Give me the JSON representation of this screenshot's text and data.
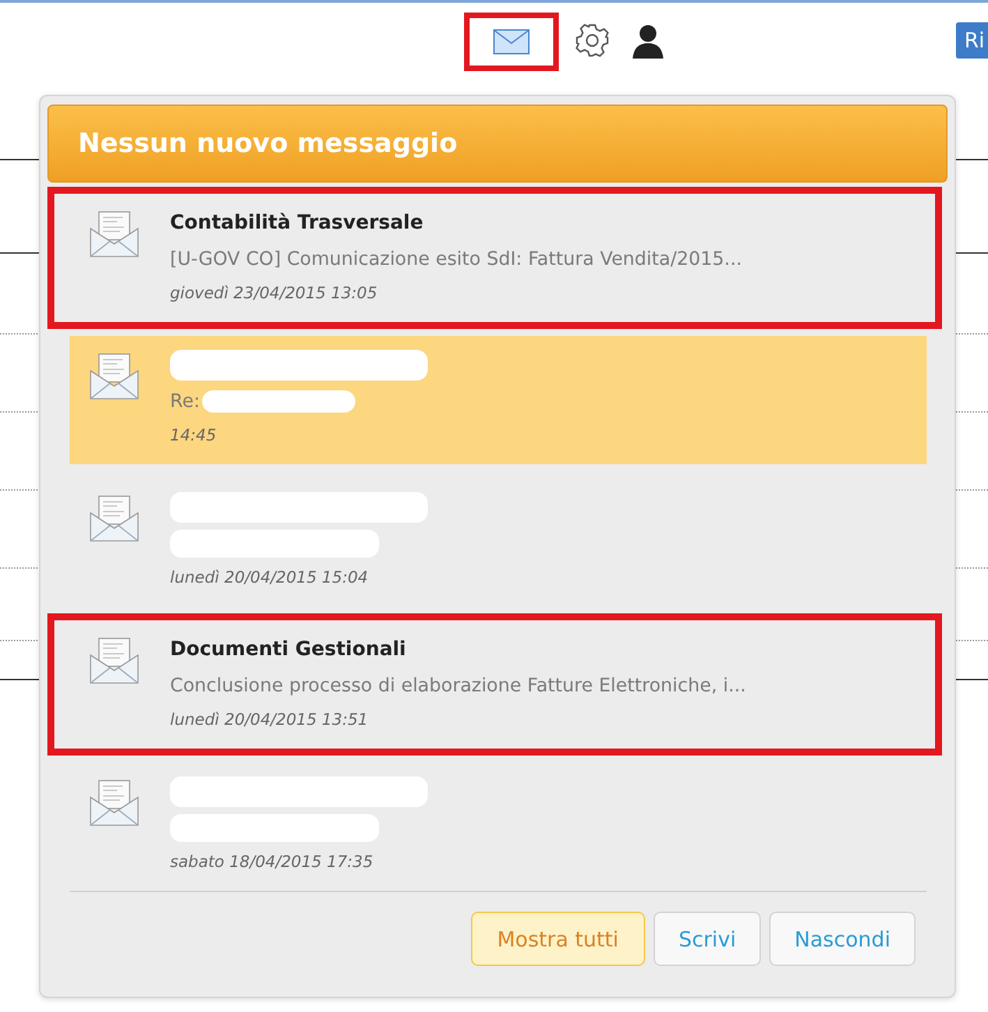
{
  "toolbar": {
    "mail_highlighted": true,
    "cut_button_label": "Ri"
  },
  "popup": {
    "title": "Nessun nuovo messaggio",
    "messages": [
      {
        "sender": "Contabilità Trasversale",
        "subject": "[U-GOV CO] Comunicazione esito SdI: Fattura Vendita/2015...",
        "time": "giovedì 23/04/2015 13:05",
        "selected": false,
        "highlighted": true,
        "redacted": false
      },
      {
        "subject": "Re:",
        "time": "14:45",
        "selected": true,
        "highlighted": false,
        "redacted": true
      },
      {
        "time": "lunedì 20/04/2015 15:04",
        "selected": false,
        "highlighted": false,
        "redacted": true
      },
      {
        "sender": "Documenti Gestionali",
        "subject": "Conclusione processo di elaborazione Fatture Elettroniche, i...",
        "time": "lunedì 20/04/2015 13:51",
        "selected": false,
        "highlighted": true,
        "redacted": false
      },
      {
        "time": "sabato 18/04/2015 17:35",
        "selected": false,
        "highlighted": false,
        "redacted": true
      }
    ],
    "buttons": [
      {
        "label": "Mostra tutti",
        "kind": "primary"
      },
      {
        "label": "Scrivi",
        "kind": "secondary"
      },
      {
        "label": "Nascondi",
        "kind": "secondary"
      }
    ]
  }
}
